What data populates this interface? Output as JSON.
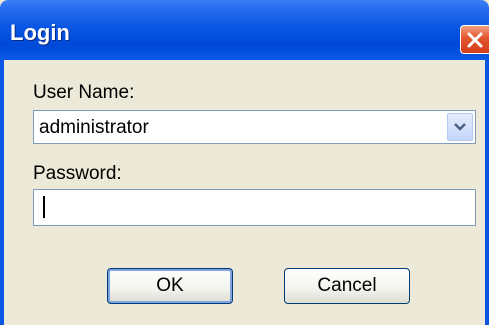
{
  "window": {
    "title": "Login",
    "close_icon": "close-icon"
  },
  "form": {
    "username_label": "User Name:",
    "username_value": "administrator",
    "dropdown_icon": "chevron-down-icon",
    "password_label": "Password:",
    "password_value": ""
  },
  "buttons": {
    "ok_label": "OK",
    "cancel_label": "Cancel"
  },
  "colors": {
    "titlebar": "#0a56e3",
    "window_bg": "#ece9d8",
    "close_red": "#e2542c",
    "field_border": "#7f9db9"
  }
}
